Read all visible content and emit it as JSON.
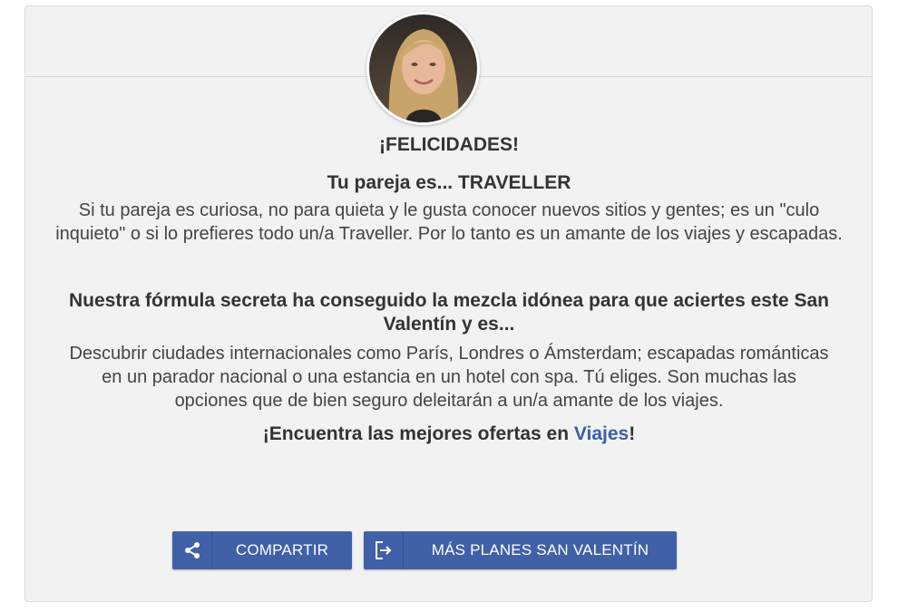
{
  "result": {
    "congrats": "¡FELICIDADES!",
    "type_line": "Tu pareja es... TRAVELLER",
    "description": "Si tu pareja es curiosa, no para quieta y le gusta conocer nuevos sitios y gentes; es un \"culo inquieto\" o si lo prefieres todo un/a Traveller. Por lo tanto es un amante de los viajes y escapadas."
  },
  "recommendation": {
    "heading": "Nuestra fórmula secreta ha conseguido la mezcla idónea para que aciertes este San Valentín y es...",
    "body": "Descubrir ciudades internacionales como París, Londres o Ámsterdam; escapadas románticas en un parador nacional o una estancia en un hotel con spa. Tú eliges. Son muchas las opciones que de bien seguro deleitarán a un/a amante de los viajes.",
    "cta_prefix": "¡Encuentra las mejores ofertas en ",
    "cta_link": "Viajes",
    "cta_suffix": "!"
  },
  "buttons": {
    "share_label": "COMPARTIR",
    "share_icon": "share-icon",
    "more_label": "MÁS PLANES SAN VALENTÍN",
    "more_icon": "exit-icon"
  },
  "colors": {
    "button_bg": "#4060a8",
    "link": "#3a5fa8",
    "card_bg": "#f2f2f2"
  }
}
